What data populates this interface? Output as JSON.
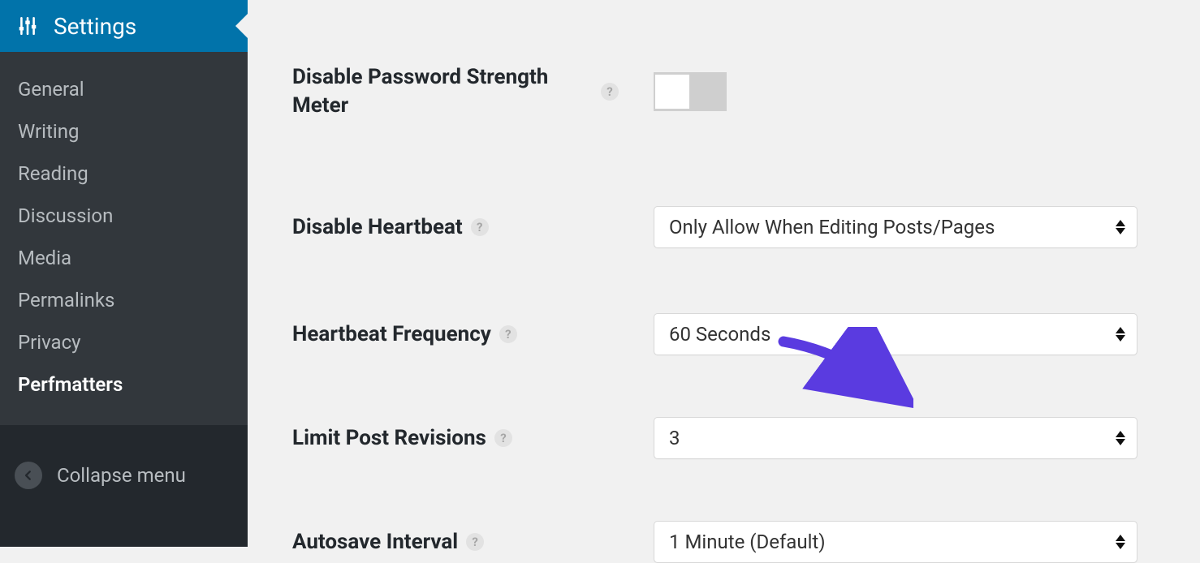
{
  "sidebar": {
    "active_label": "Settings",
    "items": [
      {
        "label": "General"
      },
      {
        "label": "Writing"
      },
      {
        "label": "Reading"
      },
      {
        "label": "Discussion"
      },
      {
        "label": "Media"
      },
      {
        "label": "Permalinks"
      },
      {
        "label": "Privacy"
      },
      {
        "label": "Perfmatters"
      }
    ],
    "collapse_label": "Collapse menu"
  },
  "settings": {
    "disable_password_meter": {
      "label": "Disable Password Strength Meter",
      "value": false
    },
    "disable_heartbeat": {
      "label": "Disable Heartbeat",
      "value": "Only Allow When Editing Posts/Pages"
    },
    "heartbeat_frequency": {
      "label": "Heartbeat Frequency",
      "value": "60 Seconds"
    },
    "limit_post_revisions": {
      "label": "Limit Post Revisions",
      "value": "3"
    },
    "autosave_interval": {
      "label": "Autosave Interval",
      "value": "1 Minute (Default)"
    }
  },
  "help_glyph": "?"
}
